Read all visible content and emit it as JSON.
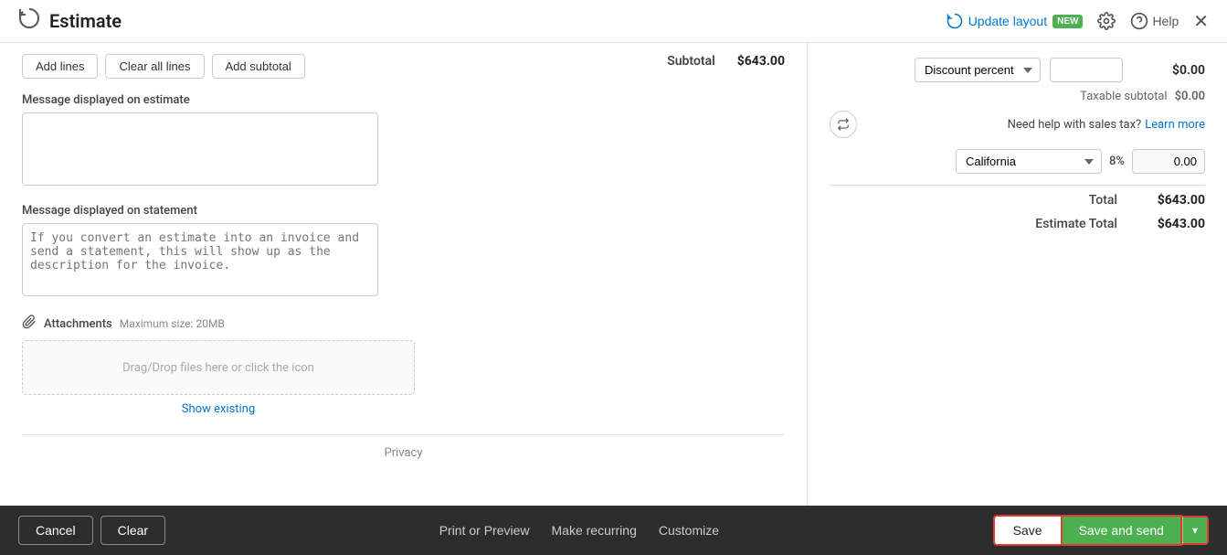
{
  "header": {
    "logo_icon": "estimate-icon",
    "title": "Estimate",
    "update_layout": "Update layout",
    "new_badge": "NEW",
    "help_label": "Help"
  },
  "top_buttons": {
    "add_lines": "Add lines",
    "clear_all_lines": "Clear all lines",
    "add_subtotal": "Add subtotal"
  },
  "form": {
    "message_on_estimate_label": "Message displayed on estimate",
    "message_on_estimate_value": "",
    "message_on_statement_label": "Message displayed on statement",
    "message_on_statement_placeholder": "If you convert an estimate into an invoice and send a statement, this will show up as the description for the invoice.",
    "attachments_label": "Attachments",
    "max_size": "Maximum size: 20MB",
    "drop_zone_text": "Drag/Drop files here or click the icon",
    "show_existing": "Show existing"
  },
  "privacy": {
    "label": "Privacy"
  },
  "summary": {
    "subtotal_label": "Subtotal",
    "subtotal_value": "$643.00",
    "discount_label": "Discount percent",
    "discount_input_value": "",
    "discount_value": "$0.00",
    "taxable_subtotal_label": "Taxable subtotal",
    "taxable_subtotal_value": "$0.00",
    "help_text": "Need help with sales tax?",
    "learn_more": "Learn more",
    "state_value": "California",
    "tax_percent": "8%",
    "tax_input_value": "0.00",
    "total_label": "Total",
    "total_value": "$643.00",
    "estimate_total_label": "Estimate Total",
    "estimate_total_value": "$643.00"
  },
  "footer": {
    "cancel": "Cancel",
    "clear": "Clear",
    "print_or_preview": "Print or Preview",
    "make_recurring": "Make recurring",
    "customize": "Customize",
    "save": "Save",
    "save_and_send": "Save and send"
  }
}
